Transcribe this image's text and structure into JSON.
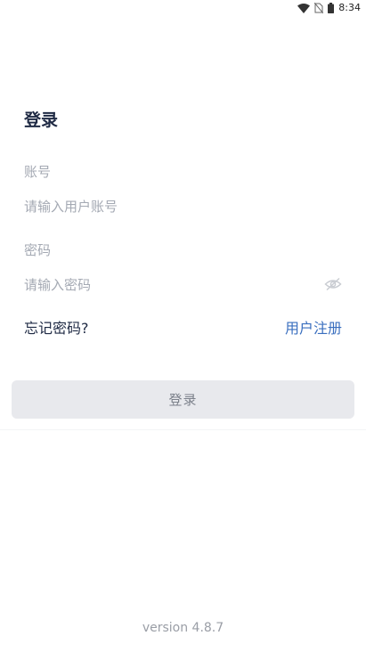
{
  "status_bar": {
    "time": "8:34",
    "icons": [
      "wifi-icon",
      "no-sim-icon",
      "battery-icon"
    ]
  },
  "login": {
    "title": "登录",
    "account_label": "账号",
    "account_placeholder": "请输入用户账号",
    "account_value": "",
    "password_label": "密码",
    "password_placeholder": "请输入密码",
    "password_value": "",
    "password_toggle_icon": "eye-hidden-icon",
    "forgot_password": "忘记密码?",
    "register": "用户注册",
    "submit_label": "登录"
  },
  "footer": {
    "version": "version 4.8.7"
  },
  "colors": {
    "title": "#1f2a44",
    "placeholder": "#a4a9b3",
    "link_accent": "#3a6fbf",
    "button_bg": "#e8e9ed",
    "button_text": "#7b808a",
    "version_text": "#9a9ea6"
  }
}
